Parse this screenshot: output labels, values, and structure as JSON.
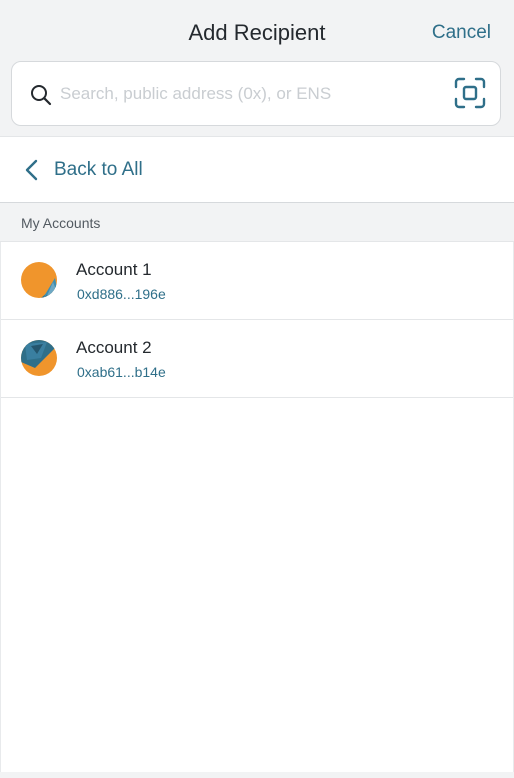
{
  "header": {
    "title": "Add Recipient",
    "cancel_label": "Cancel"
  },
  "search": {
    "placeholder": "Search, public address (0x), or ENS",
    "value": ""
  },
  "back": {
    "label": "Back to All"
  },
  "section": {
    "label": "My Accounts"
  },
  "accounts": [
    {
      "name": "Account 1",
      "address": "0xd886...196e"
    },
    {
      "name": "Account 2",
      "address": "0xab61...b14e"
    }
  ],
  "colors": {
    "accent": "#2f6f89",
    "background": "#f2f3f4",
    "avatar_orange": "#f0952c",
    "avatar_teal": "#2f6f89"
  },
  "icons": {
    "search": "search-icon",
    "scan": "qr-scan-icon",
    "back": "chevron-left-icon"
  }
}
